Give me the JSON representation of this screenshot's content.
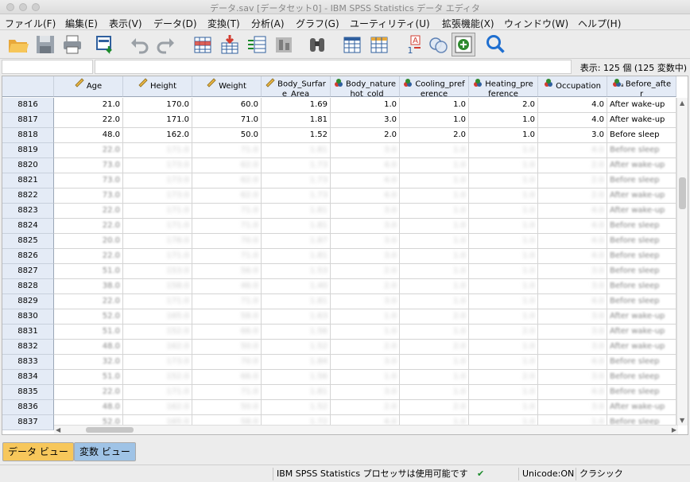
{
  "window": {
    "title": "データ.sav [データセット0] - IBM SPSS Statistics データ エディタ"
  },
  "menu": [
    "ファイル(F)",
    "編集(E)",
    "表示(V)",
    "データ(D)",
    "変換(T)",
    "分析(A)",
    "グラフ(G)",
    "ユーティリティ(U)",
    "拡張機能(X)",
    "ウィンドウ(W)",
    "ヘルプ(H)"
  ],
  "cellbar": {
    "ref": "",
    "value": "",
    "var_count": "表示: 125 個 (125 変数中)"
  },
  "columns": [
    {
      "label": "Age",
      "icon": "ruler-icon"
    },
    {
      "label": "Height",
      "icon": "ruler-icon"
    },
    {
      "label": "Weight",
      "icon": "ruler-icon"
    },
    {
      "label": "Body_Surfare_Area",
      "icon": "ruler-icon"
    },
    {
      "label": "Body_nature_hot_cold",
      "icon": "nominal-icon"
    },
    {
      "label": "Cooling_preference",
      "icon": "nominal-icon"
    },
    {
      "label": "Heating_preference",
      "icon": "nominal-icon"
    },
    {
      "label": "Occupation",
      "icon": "nominal-icon"
    },
    {
      "label": "Before_after",
      "icon": "nominal-string-icon"
    }
  ],
  "rows": [
    {
      "id": "8816",
      "v": [
        "21.0",
        "170.0",
        "60.0",
        "1.69",
        "1.0",
        "1.0",
        "2.0",
        "4.0",
        "After wake-up"
      ]
    },
    {
      "id": "8817",
      "v": [
        "22.0",
        "171.0",
        "71.0",
        "1.81",
        "3.0",
        "1.0",
        "1.0",
        "4.0",
        "After wake-up"
      ]
    },
    {
      "id": "8818",
      "v": [
        "48.0",
        "162.0",
        "50.0",
        "1.52",
        "2.0",
        "2.0",
        "1.0",
        "3.0",
        "Before sleep"
      ]
    },
    {
      "id": "8819",
      "v": [
        "22.0",
        "171.0",
        "71.0",
        "1.81",
        "3.0",
        "1.0",
        "1.0",
        "4.0",
        "Before sleep"
      ]
    },
    {
      "id": "8820",
      "v": [
        "73.0",
        "173.0",
        "62.0",
        "1.73",
        "4.0",
        "1.0",
        "1.0",
        "2.0",
        "After wake-up"
      ]
    },
    {
      "id": "8821",
      "v": [
        "73.0",
        "173.0",
        "62.0",
        "1.73",
        "4.0",
        "1.0",
        "1.0",
        "2.0",
        "Before sleep"
      ]
    },
    {
      "id": "8822",
      "v": [
        "73.0",
        "173.0",
        "62.0",
        "1.73",
        "4.0",
        "1.0",
        "1.0",
        "2.0",
        "After wake-up"
      ]
    },
    {
      "id": "8823",
      "v": [
        "22.0",
        "171.0",
        "71.0",
        "1.81",
        "3.0",
        "1.0",
        "1.0",
        "4.0",
        "After wake-up"
      ]
    },
    {
      "id": "8824",
      "v": [
        "22.0",
        "171.0",
        "71.0",
        "1.81",
        "3.0",
        "1.0",
        "1.0",
        "4.0",
        "Before sleep"
      ]
    },
    {
      "id": "8825",
      "v": [
        "20.0",
        "178.0",
        "70.0",
        "1.87",
        "3.0",
        "1.0",
        "1.0",
        "4.0",
        "Before sleep"
      ]
    },
    {
      "id": "8826",
      "v": [
        "22.0",
        "171.0",
        "71.0",
        "1.81",
        "3.0",
        "1.0",
        "1.0",
        "4.0",
        "Before sleep"
      ]
    },
    {
      "id": "8827",
      "v": [
        "51.0",
        "153.0",
        "56.0",
        "1.53",
        "2.0",
        "1.0",
        "1.0",
        "3.0",
        "Before sleep"
      ]
    },
    {
      "id": "8828",
      "v": [
        "38.0",
        "158.0",
        "46.0",
        "1.40",
        "2.0",
        "1.0",
        "1.0",
        "3.0",
        "Before sleep"
      ]
    },
    {
      "id": "8829",
      "v": [
        "22.0",
        "171.0",
        "71.0",
        "1.81",
        "3.0",
        "1.0",
        "1.0",
        "4.0",
        "Before sleep"
      ]
    },
    {
      "id": "8830",
      "v": [
        "52.0",
        "165.0",
        "58.0",
        "1.63",
        "1.0",
        "2.0",
        "1.0",
        "3.0",
        "After wake-up"
      ]
    },
    {
      "id": "8831",
      "v": [
        "51.0",
        "152.0",
        "66.0",
        "1.56",
        "1.0",
        "1.0",
        "2.0",
        "3.0",
        "After wake-up"
      ]
    },
    {
      "id": "8832",
      "v": [
        "48.0",
        "162.0",
        "50.0",
        "1.52",
        "2.0",
        "2.0",
        "1.0",
        "3.0",
        "After wake-up"
      ]
    },
    {
      "id": "8833",
      "v": [
        "32.0",
        "173.0",
        "70.0",
        "1.84",
        "3.0",
        "1.0",
        "1.0",
        "4.0",
        "Before sleep"
      ]
    },
    {
      "id": "8834",
      "v": [
        "51.0",
        "152.0",
        "66.0",
        "1.56",
        "1.0",
        "1.0",
        "2.0",
        "3.0",
        "Before sleep"
      ]
    },
    {
      "id": "8835",
      "v": [
        "22.0",
        "171.0",
        "71.0",
        "1.81",
        "3.0",
        "1.0",
        "1.0",
        "4.0",
        "Before sleep"
      ]
    },
    {
      "id": "8836",
      "v": [
        "48.0",
        "162.0",
        "50.0",
        "1.52",
        "2.0",
        "2.0",
        "1.0",
        "3.0",
        "After wake-up"
      ]
    },
    {
      "id": "8837",
      "v": [
        "52.0",
        "165.0",
        "58.0",
        "1.72",
        "4.0",
        "1.0",
        "1.0",
        "1.0",
        "Before sleep"
      ]
    }
  ],
  "tabs": {
    "data_view": "データ ビュー",
    "variable_view": "変数 ビュー"
  },
  "status": {
    "processor": "IBM SPSS Statistics プロセッサは使用可能です",
    "unicode": "Unicode:ON",
    "mode": "クラシック"
  },
  "colors": {
    "header_bg": "#e4ebf6",
    "active_tab": "#f7c75b",
    "inactive_tab": "#9fc3e6"
  }
}
